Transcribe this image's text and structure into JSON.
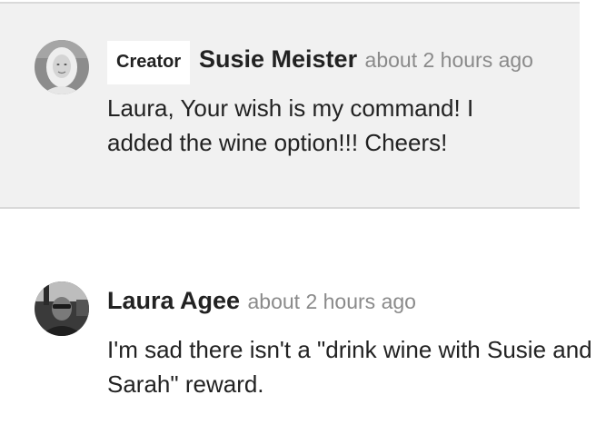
{
  "comments": [
    {
      "badge": "Creator",
      "author": "Susie Meister",
      "time": "about 2 hours ago",
      "text": "Laura, Your wish is my command! I added the wine option!!! Cheers!",
      "avatar_icon": "user-avatar-photo"
    },
    {
      "author": "Laura Agee",
      "time": "about 2 hours ago",
      "text": "I'm sad there isn't a \"drink wine with Susie and Sarah\" reward.",
      "avatar_icon": "user-avatar-photo"
    }
  ],
  "colors": {
    "creator_comment_bg": "#f1f1f1",
    "divider": "#d9d9d9",
    "author_text": "#222222",
    "timestamp_text": "#8a8a8a",
    "badge_bg": "#ffffff"
  }
}
